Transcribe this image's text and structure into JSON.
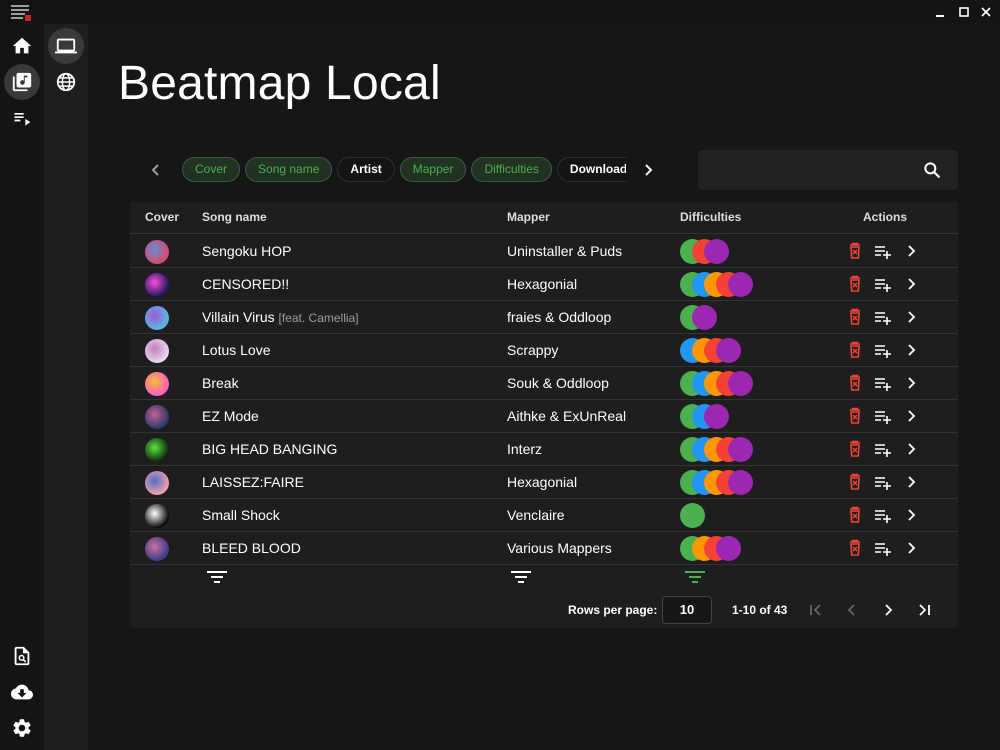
{
  "page": {
    "title": "Beatmap Local"
  },
  "window": {
    "minimize": "minimize",
    "maximize": "maximize",
    "close": "close"
  },
  "rail": {
    "items": [
      {
        "icon": "home-icon"
      },
      {
        "icon": "library-icon",
        "active": true
      },
      {
        "icon": "playlist-icon"
      }
    ],
    "bottom": [
      {
        "icon": "file-search-icon"
      },
      {
        "icon": "cloud-download-icon"
      },
      {
        "icon": "settings-icon"
      }
    ]
  },
  "subrail": {
    "items": [
      {
        "icon": "laptop-icon",
        "active": true
      },
      {
        "icon": "globe-icon"
      }
    ]
  },
  "chips": [
    {
      "label": "Cover",
      "on": true
    },
    {
      "label": "Song name",
      "on": true
    },
    {
      "label": "Artist",
      "on": false
    },
    {
      "label": "Mapper",
      "on": true
    },
    {
      "label": "Difficulties",
      "on": true
    },
    {
      "label": "Downloads",
      "on": false
    }
  ],
  "search": {
    "value": "",
    "placeholder": ""
  },
  "table": {
    "headers": {
      "cover": "Cover",
      "song": "Song name",
      "mapper": "Mapper",
      "difficulties": "Difficulties",
      "actions": "Actions"
    },
    "rows": [
      {
        "song": "Sengoku HOP",
        "feat": "",
        "mapper": "Uninstaller & Puds",
        "diffs": [
          "#4caf50",
          "#f44336",
          "#9c27b0"
        ]
      },
      {
        "song": "CENSORED!!",
        "feat": "",
        "mapper": "Hexagonial",
        "diffs": [
          "#4caf50",
          "#2196f3",
          "#ff9800",
          "#f44336",
          "#9c27b0"
        ]
      },
      {
        "song": "Villain Virus",
        "feat": "[feat. Camellia]",
        "mapper": "fraies & Oddloop",
        "diffs": [
          "#4caf50",
          "#9c27b0"
        ]
      },
      {
        "song": "Lotus Love",
        "feat": "",
        "mapper": "Scrappy",
        "diffs": [
          "#2196f3",
          "#ff9800",
          "#f44336",
          "#9c27b0"
        ]
      },
      {
        "song": "Break",
        "feat": "",
        "mapper": "Souk & Oddloop",
        "diffs": [
          "#4caf50",
          "#2196f3",
          "#ff9800",
          "#f44336",
          "#9c27b0"
        ]
      },
      {
        "song": "EZ Mode",
        "feat": "",
        "mapper": "Aithke & ExUnReal",
        "diffs": [
          "#4caf50",
          "#2196f3",
          "#9c27b0"
        ]
      },
      {
        "song": "BIG HEAD BANGING",
        "feat": "",
        "mapper": "Interz",
        "diffs": [
          "#4caf50",
          "#2196f3",
          "#ff9800",
          "#f44336",
          "#9c27b0"
        ]
      },
      {
        "song": "LAISSEZ:FAIRE",
        "feat": "",
        "mapper": "Hexagonial",
        "diffs": [
          "#4caf50",
          "#2196f3",
          "#ff9800",
          "#f44336",
          "#9c27b0"
        ]
      },
      {
        "song": "Small Shock",
        "feat": "",
        "mapper": "Venclaire",
        "diffs": [
          "#4caf50"
        ]
      },
      {
        "song": "BLEED BLOOD",
        "feat": "",
        "mapper": "Various Mappers",
        "diffs": [
          "#4caf50",
          "#ff9800",
          "#f44336",
          "#9c27b0"
        ]
      }
    ],
    "covers": [
      [
        "#d84a6a",
        "#6a8ad8"
      ],
      [
        "#1a1a5e",
        "#ff4ad8"
      ],
      [
        "#58b8e8",
        "#a05ad0"
      ],
      [
        "#e8d8f0",
        "#c080c0"
      ],
      [
        "#ff5ac8",
        "#f0c030"
      ],
      [
        "#2a3a6a",
        "#c06090"
      ],
      [
        "#0a2a0a",
        "#60e040"
      ],
      [
        "#f0a0b0",
        "#5070c0"
      ],
      [
        "#0a0a0a",
        "#ffffff"
      ],
      [
        "#3a3a8a",
        "#d070a0"
      ]
    ]
  },
  "footer": {
    "rows_per_page_label": "Rows per page:",
    "rows_per_page": "10",
    "range": "1-10 of 43"
  },
  "colors": {
    "accent": "#4caf50",
    "delete": "#f44336",
    "bg": "#161616",
    "panel": "#1e1e1e"
  }
}
